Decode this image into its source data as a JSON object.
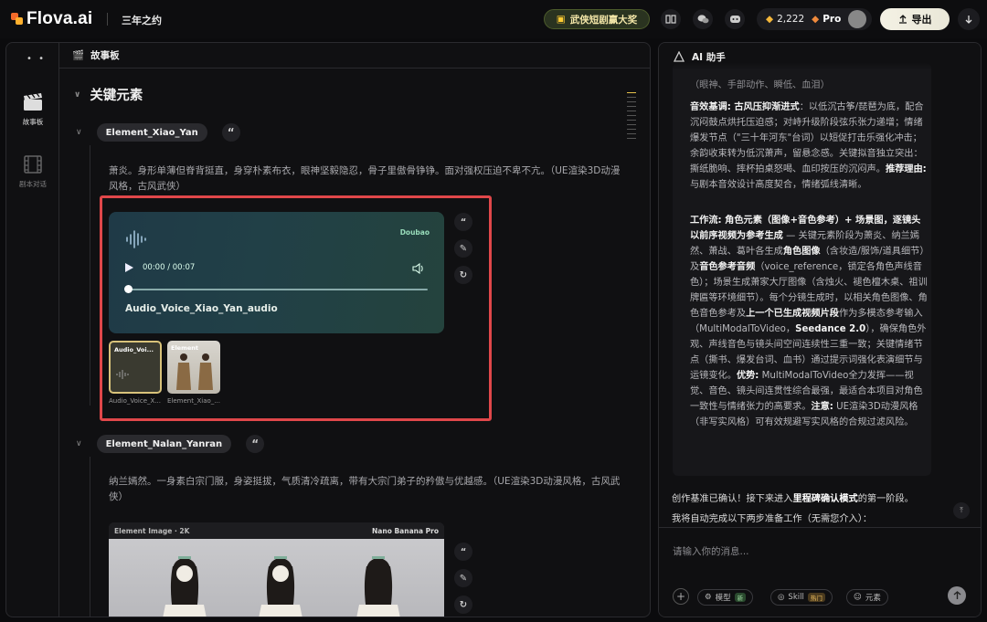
{
  "app": {
    "logo": "Flova.ai",
    "project_title": "三年之约",
    "promo_label": "武侠短剧赢大奖",
    "credits": "2,222",
    "plan": "Pro",
    "export_label": "导出"
  },
  "storyboard": {
    "rail_items": [
      "故事板",
      "剧本对话"
    ],
    "panel_title": "故事板",
    "section_title": "关键元素",
    "elements": [
      {
        "name": "Element_Xiao_Yan",
        "description": "萧炎。身形单薄但脊背挺直，身穿朴素布衣，眼神坚毅隐忍，骨子里傲骨铮铮。面对强权压迫不卑不亢。（UE渲染3D动漫风格，古风武侠）",
        "audio": {
          "provider": "Doubao",
          "time": "00:00 / 00:07",
          "progress": 0,
          "title": "Audio_Voice_Xiao_Yan_audio"
        },
        "thumbnails": [
          {
            "tag": "Audio_Voi...",
            "caption": "Audio_Voice_X..."
          },
          {
            "tag": "Element",
            "caption": "Element_Xiao_..."
          }
        ]
      },
      {
        "name": "Element_Nalan_Yanran",
        "description": "纳兰嫣然。一身素白宗门服，身姿挺拔，气质清冷疏离，带有大宗门弟子的矜傲与优越感。（UE渲染3D动漫风格，古风武侠）",
        "image_card": {
          "label": "Element Image",
          "resolution": "2K",
          "model": "Nano Banana Pro"
        }
      }
    ]
  },
  "assistant": {
    "title": "AI 助手",
    "msg_lines_top": "（眼神、手部动作、瞬低、血泪）",
    "audio_para": {
      "label": "音效基调: 古风压抑渐进式",
      "text": "：以低沉古筝/琵琶为底，配合沉闷鼓点烘托压迫感；对峙升级阶段弦乐张力递增；情绪爆发节点（\"三十年河东\"台词）以短促打击乐强化冲击；余韵收束转为低沉萧声，留悬念感。关键拟音独立突出：撕纸脆响、摔杯拍桌怒喝、血印按压的沉闷声。",
      "reason_label": "推荐理由:",
      "reason_text": " 与剧本音效设计高度契合，情绪弧线清晰。"
    },
    "workflow_para": {
      "label": "工作流: 角色元素（图像+音色参考）+ 场景图，逐镜头以前序视频为参考生成",
      "p1": " — 关键元素阶段为萧炎、纳兰嫣然、萧战、葛叶各生成",
      "b1": "角色图像",
      "p2": "（含妆造/服饰/道具细节）及",
      "b2": "音色参考音频",
      "p3": "（voice_reference，锁定各角色声线音色）；场景生成萧家大厅图像（含烛火、褪色檀木桌、祖训牌匾等环境细节）。每个分镜生成时，以相关角色图像、角色音色参考及",
      "b3": "上一个已生成视频片段",
      "p4": "作为多模态参考输入（MultiModalToVideo，",
      "b4": "Seedance 2.0",
      "p5": "），确保角色外观、声线音色与镜头间空间连续性三重一致；关键情绪节点（撕书、爆发台词、血书）通过提示词强化表演细节与运镜变化。",
      "b5": "优势:",
      "p6": " MultiModalToVideo全力发挥——视觉、音色、镜头间连贯性综合最强，最适合本项目对角色一致性与情绪张力的高要求。",
      "b6": "注意:",
      "p7": " UE渲染3D动漫风格（非写实风格）可有效规避写实风格的合规过滤风险。"
    },
    "confirm": {
      "pre": "创作基准已确认！接下来进入",
      "bold": "里程碑确认模式",
      "post": "的第一阶段。"
    },
    "auto_note": "我将自动完成以下两步准备工作（无需您介入）：",
    "input_placeholder": "请输入你的消息...",
    "chips": [
      {
        "label": "模型",
        "badge": "新"
      },
      {
        "label": "Skill",
        "badge": "热门"
      },
      {
        "label": "元素",
        "badge": ""
      }
    ]
  },
  "colors": {
    "accent_red": "#e0474a",
    "audio_card": "#214047",
    "background": "#0b0b0d"
  }
}
